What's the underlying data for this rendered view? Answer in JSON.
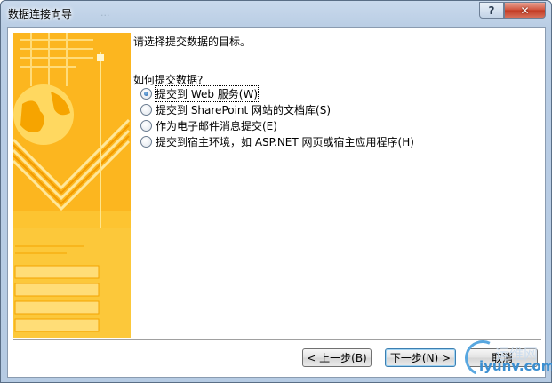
{
  "window": {
    "title": "数据连接向导",
    "ghost_title": "...",
    "help_label": "?",
    "close_label": "✕"
  },
  "content": {
    "heading": "请选择提交数据的目标。",
    "question": "如何提交数据?",
    "options": [
      {
        "label": "提交到 Web 服务(W)",
        "checked": true
      },
      {
        "label": "提交到 SharePoint 网站的文档库(S)",
        "checked": false
      },
      {
        "label": "作为电子邮件消息提交(E)",
        "checked": false
      },
      {
        "label": "提交到宿主环境，如 ASP.NET 网页或宿主应用程序(H)",
        "checked": false
      }
    ]
  },
  "buttons": {
    "back": "< 上一步(B)",
    "next": "下一步(N) >",
    "cancel": "取消"
  },
  "watermark": {
    "top": "运维网",
    "bottom": "iyunv.com"
  },
  "colors": {
    "sidebar_bg": "#fdc431",
    "sidebar_light": "#ffe78a",
    "sidebar_line": "#f5a300",
    "accent": "#3c7fb1"
  }
}
